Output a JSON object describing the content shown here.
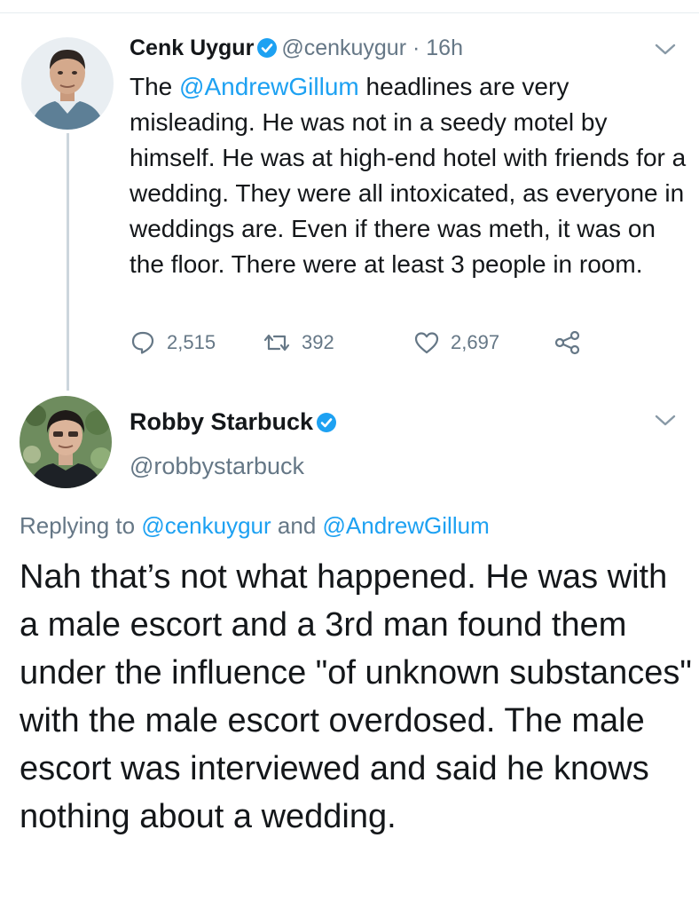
{
  "tweet1": {
    "author_name": "Cenk Uygur",
    "handle": "@cenkuygur",
    "separator": "·",
    "time": "16h",
    "text_before": "The ",
    "mention": "@AndrewGillum",
    "text_after": " headlines are very misleading. He was not in a seedy motel by himself. He was at high-end hotel with friends for a wedding. They were all intoxicated, as everyone in weddings are. Even if there was meth, it was on the floor. There were at least 3 people in room.",
    "replies": "2,515",
    "retweets": "392",
    "likes": "2,697"
  },
  "tweet2": {
    "author_name": "Robby Starbuck",
    "handle": "@robbystarbuck",
    "replying_prefix": "Replying to ",
    "replying_mention1": "@cenkuygur",
    "replying_and": " and ",
    "replying_mention2": "@AndrewGillum",
    "text": "Nah that’s not what happened. He was with a male escort and a 3rd man found them under the influence \"of unknown substances\" with the male escort overdosed. The male escort was interviewed and said he knows nothing about a wedding."
  },
  "colors": {
    "accent": "#1da1f2",
    "secondary_text": "#657786",
    "primary_text": "#14171a",
    "thread_line": "#ccd6dd"
  },
  "icons": [
    "verified-badge-icon",
    "chevron-down-icon",
    "reply-icon",
    "retweet-icon",
    "like-icon",
    "share-icon"
  ]
}
